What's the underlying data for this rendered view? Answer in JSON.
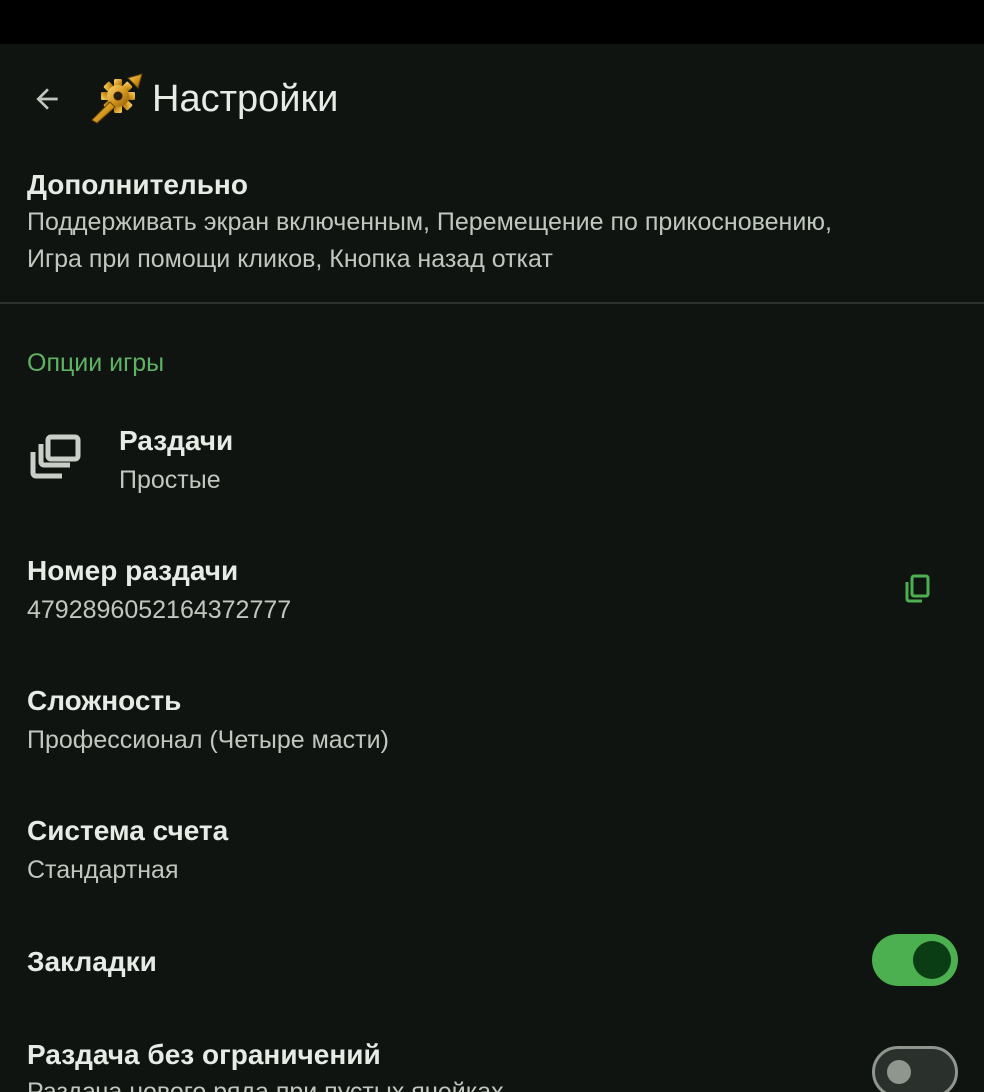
{
  "app_bar": {
    "title": "Настройки",
    "back_icon": "arrow-back-icon",
    "app_icon": "golden-gear-icon"
  },
  "advanced": {
    "title": "Дополнительно",
    "summary_line1": "Поддерживать экран включенным, Перемещение по прикосновению,",
    "summary_line2": "Игра при помощи кликов, Кнопка назад откат"
  },
  "category": {
    "title": "Опции игры",
    "color": "#5fb164"
  },
  "preferences": {
    "deals": {
      "title": "Раздачи",
      "summary": "Простые",
      "icon": "library-stack-icon"
    },
    "deal_number": {
      "title": "Номер раздачи",
      "summary": "4792896052164372777",
      "action_icon": "copy-icon"
    },
    "difficulty": {
      "title": "Сложность",
      "summary": "Профессионал (Четыре масти)"
    },
    "scoring": {
      "title": "Система счета",
      "summary": "Стандартная"
    },
    "bookmarks": {
      "title": "Закладки",
      "checked": true
    },
    "unlimited_deal": {
      "title": "Раздача без ограничений",
      "summary": "Раздача нового ряда при пустых ячейках",
      "checked": false
    }
  },
  "colors": {
    "background": "#101411",
    "accent": "#4caf50",
    "text_primary": "#e7ebe6",
    "text_secondary": "#c0c7bf"
  }
}
